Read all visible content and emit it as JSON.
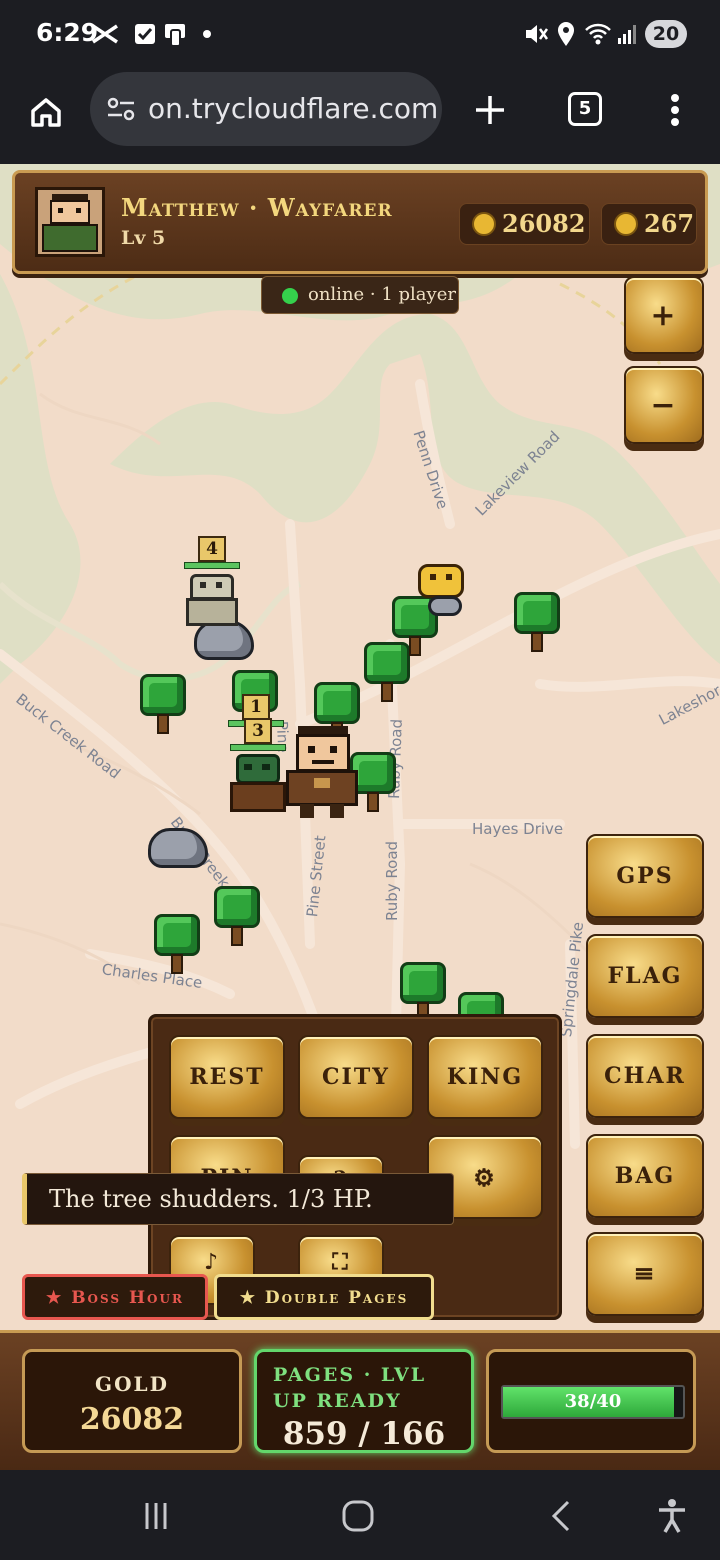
{
  "status_bar": {
    "time": "6:29",
    "battery": "20",
    "icons": [
      "capcut-icon",
      "checkbox-icon",
      "phone-app-icon",
      "notification-dot-icon",
      "mute-icon",
      "location-icon",
      "wifi-icon",
      "signal-icon"
    ]
  },
  "browser": {
    "url": "on.trycloudflare.com",
    "tab_count": "5",
    "icons": [
      "home-icon",
      "site-settings-icon",
      "new-tab-icon",
      "more-vert-icon"
    ]
  },
  "player": {
    "name": "Matthew · Wayfarer",
    "level": "Lv 5",
    "gold": "26082",
    "gems": "267"
  },
  "online_status": "online · 1 player",
  "map": {
    "zoom_in": "+",
    "zoom_out": "−",
    "streets": [
      "Penn Drive",
      "Lakeview Road",
      "Lakeshore",
      "Buck Creek Road",
      "Buck Creek Road",
      "Pine Street",
      "Ruby Road",
      "Ruby Road",
      "Hayes Drive",
      "Charles Place",
      "Pine",
      "Springdale Pike"
    ],
    "enemy_levels": [
      "4",
      "1",
      "3"
    ]
  },
  "side_buttons": [
    "GPS",
    "FLAG",
    "CHAR",
    "BAG",
    "≡"
  ],
  "actions": {
    "row1": [
      "REST",
      "CITY",
      "KING"
    ],
    "row2": [
      "PIN",
      "?",
      "⚙"
    ],
    "row3": [
      "♪",
      "⛶"
    ]
  },
  "toast": "The tree shudders. 1/3 HP.",
  "events": [
    {
      "label": "★ Boss Hour",
      "color": "#e7574f"
    },
    {
      "label": "★ Double Pages",
      "color": "#f1dc8e"
    }
  ],
  "hud": {
    "gold_label": "GOLD",
    "gold_value": "26082",
    "pages_label": "PAGES · LVL UP READY",
    "pages_value": "859 / 166",
    "hp_text": "38/40",
    "hp_current": 38,
    "hp_max": 40
  },
  "nav": {
    "icons": [
      "recent-apps-icon",
      "home-circle-icon",
      "back-icon",
      "accessibility-icon"
    ]
  },
  "colors": {
    "map_bg": "#f2dcc9",
    "water": "#dfdfc5",
    "wood": "#5a3519",
    "gold_text": "#f3d77e",
    "accent_green": "#5cc45f"
  }
}
